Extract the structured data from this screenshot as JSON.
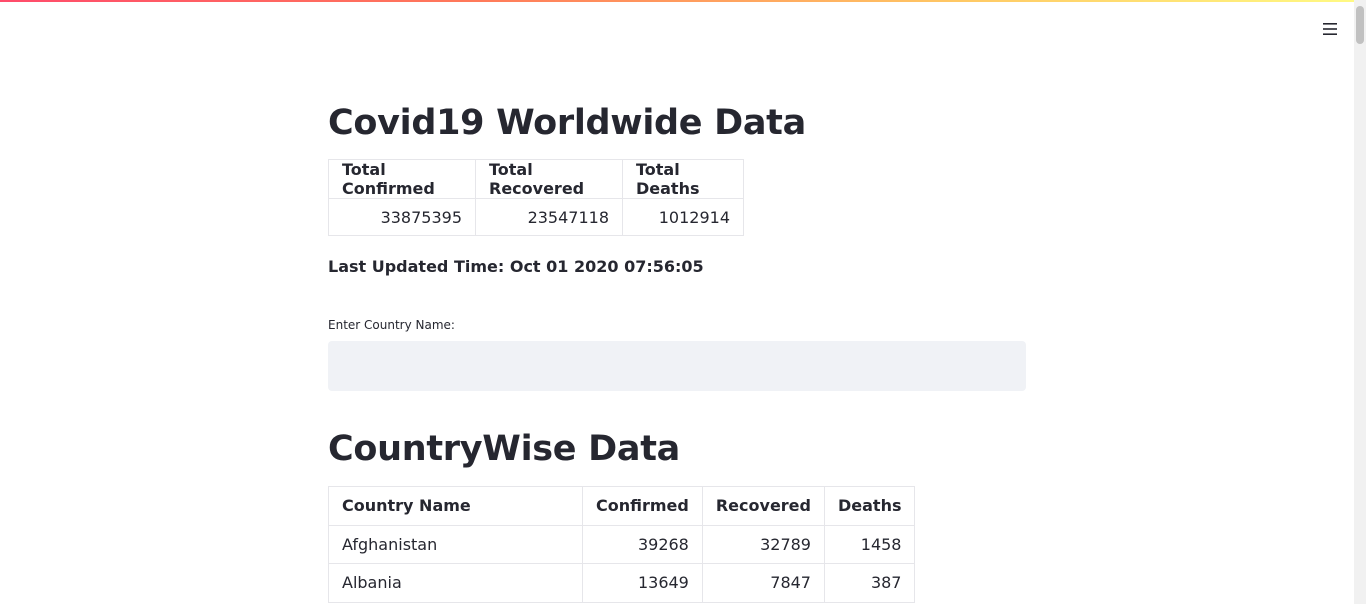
{
  "header": {
    "menu_icon": "hamburger-menu-icon",
    "accent_gradient": [
      "#ff4b6b",
      "#ffc864",
      "#fffb84"
    ]
  },
  "worldwide": {
    "title": "Covid19 Worldwide Data",
    "columns": [
      "Total Confirmed",
      "Total Recovered",
      "Total Deaths"
    ],
    "values": [
      "33875395",
      "23547118",
      "1012914"
    ],
    "last_updated": "Last Updated Time: Oct 01 2020 07:56:05"
  },
  "search": {
    "label": "Enter Country Name:",
    "value": "",
    "placeholder": ""
  },
  "countrywise": {
    "title": "CountryWise Data",
    "columns": [
      "Country Name",
      "Confirmed",
      "Recovered",
      "Deaths"
    ],
    "rows": [
      [
        "Afghanistan",
        "39268",
        "32789",
        "1458"
      ],
      [
        "Albania",
        "13649",
        "7847",
        "387"
      ]
    ]
  }
}
